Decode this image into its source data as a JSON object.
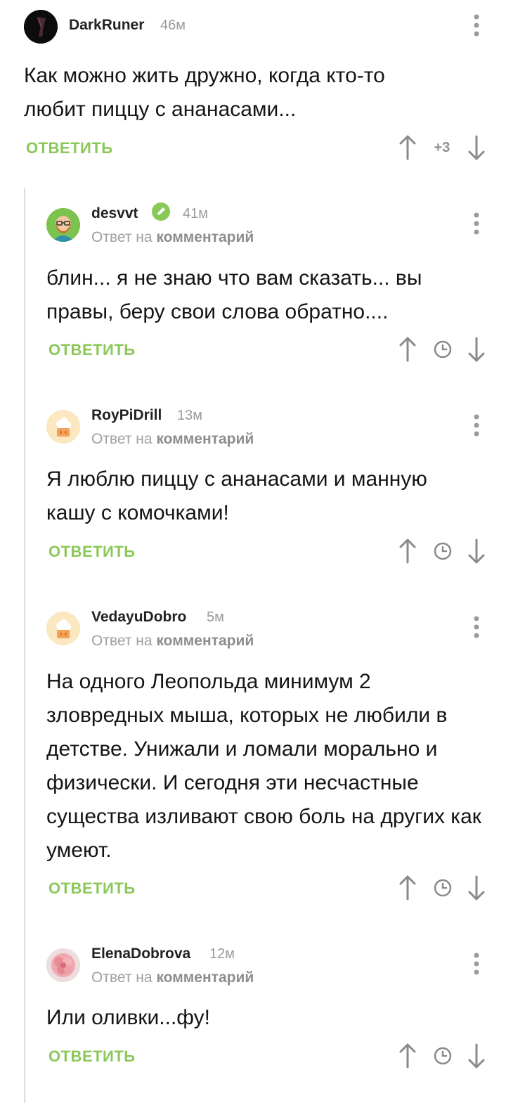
{
  "colors": {
    "accent_green": "#8ac858",
    "muted": "#9a9a9a"
  },
  "comments": [
    {
      "author": "DarkRuner",
      "time": "46м",
      "reply_to": null,
      "text": "Как можно жить дружно, когда кто-то любит пиццу с ананасами...",
      "reply_label": "ОТВЕТИТЬ",
      "rating": "+3",
      "avatar_icon": "dark-figure-avatar"
    },
    {
      "author": "desvvt",
      "time": "41м",
      "reply_to": {
        "prefix": "Ответ на",
        "target": "комментарий"
      },
      "text": "блин... я не знаю что вам сказать... вы правы, беру свои слова обратно....",
      "reply_label": "ОТВЕТИТЬ",
      "avatar_icon": "bearded-man-avatar",
      "badge_icon": "pencil-badge-icon"
    },
    {
      "author": "RoyPiDrill",
      "time": "13м",
      "reply_to": {
        "prefix": "Ответ на",
        "target": "комментарий"
      },
      "text": "Я люблю пиццу с ананасами и манную кашу с комочками!",
      "reply_label": "ОТВЕТИТЬ",
      "avatar_icon": "chef-hat-avatar"
    },
    {
      "author": "VedayuDobro",
      "time": "5м",
      "reply_to": {
        "prefix": "Ответ на",
        "target": "комментарий"
      },
      "text": "На одного Леопольда минимум 2 зловредных мыша, которых не любили в детстве. Унижали и ломали морально и физически. И сегодня эти несчастные существа изливают свою боль на других как умеют.",
      "reply_label": "ОТВЕТИТЬ",
      "avatar_icon": "chef-hat-avatar"
    },
    {
      "author": "ElenaDobrova",
      "time": "12м",
      "reply_to": {
        "prefix": "Ответ на",
        "target": "комментарий"
      },
      "text": "Или оливки...фу!",
      "reply_label": "ОТВЕТИТЬ",
      "avatar_icon": "pink-flower-avatar"
    }
  ]
}
